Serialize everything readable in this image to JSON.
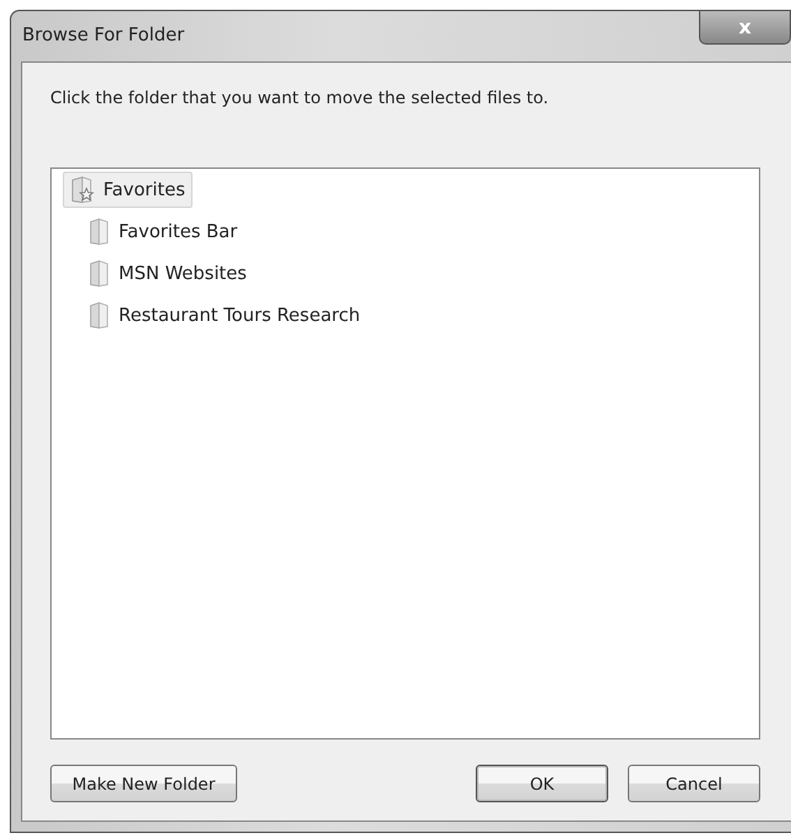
{
  "window": {
    "title": "Browse For Folder",
    "close_label": "x"
  },
  "instruction": "Click the folder that you want to move the selected files to.",
  "tree": [
    {
      "label": "Favorites",
      "kind": "favorites",
      "selected": true,
      "children": [
        {
          "label": "Favorites Bar",
          "kind": "folder",
          "selected": false
        },
        {
          "label": "MSN Websites",
          "kind": "folder",
          "selected": false
        },
        {
          "label": "Restaurant Tours Research",
          "kind": "folder",
          "selected": false
        }
      ]
    }
  ],
  "buttons": {
    "left": "Make New Folder",
    "ok": "OK",
    "cancel": "Cancel"
  }
}
